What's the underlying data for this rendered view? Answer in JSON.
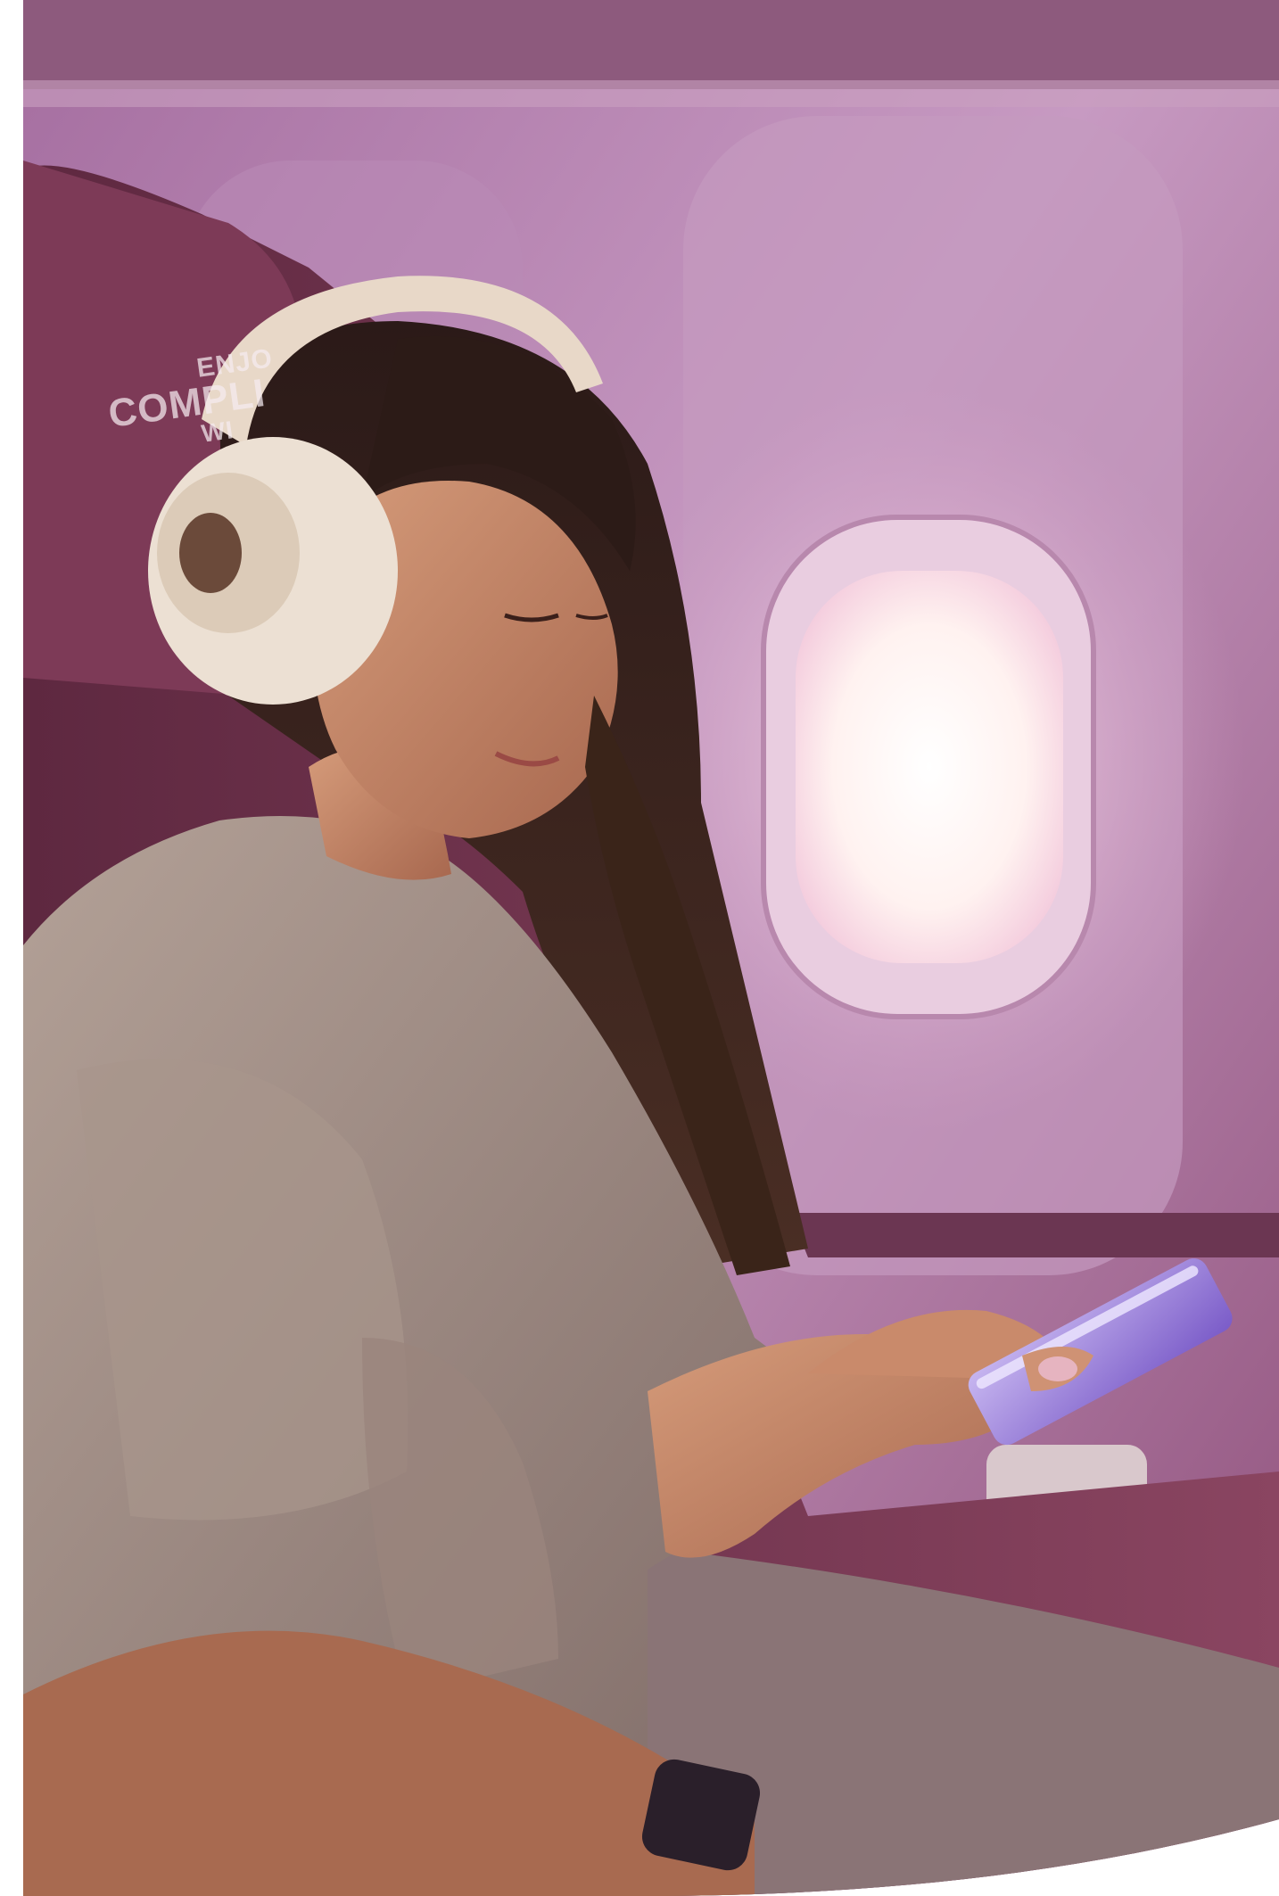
{
  "image": {
    "subject": "woman-with-headphones-using-phone-in-airplane-seat",
    "palette": {
      "cabin_wall": "#b07aa6",
      "cabin_wall_light": "#d9b4cf",
      "seat_fabric": "#7a3a52",
      "window_glow": "#fff6f4",
      "sweater": "#9e8a80",
      "headphones": "#e8d8c8",
      "phone": "#9a7ad8",
      "background": "#ffffff"
    }
  },
  "seat_label": {
    "line1": "ENJO",
    "line2": "COMPLI",
    "line3": "WI"
  }
}
